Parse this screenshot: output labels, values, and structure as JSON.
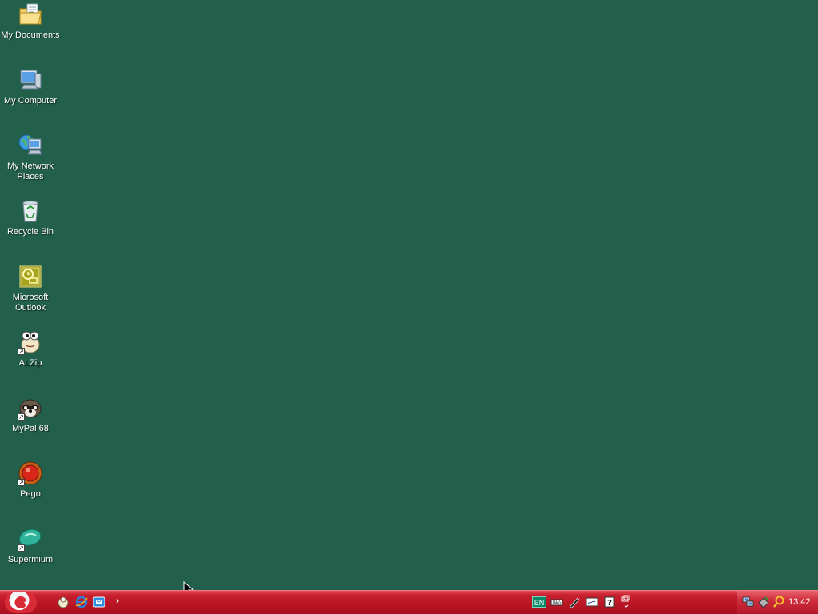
{
  "desktop": {
    "background": "#23604c",
    "icons": [
      {
        "label": "My Documents",
        "icon": "folder-documents-icon",
        "shortcut": false
      },
      {
        "label": "My Computer",
        "icon": "computer-icon",
        "shortcut": false
      },
      {
        "label": "My Network Places",
        "icon": "network-places-icon",
        "shortcut": false
      },
      {
        "label": "Recycle Bin",
        "icon": "recycle-bin-icon",
        "shortcut": false
      },
      {
        "label": "Microsoft Outlook",
        "icon": "outlook-icon",
        "shortcut": false
      },
      {
        "label": "ALZip",
        "icon": "alzip-icon",
        "shortcut": true
      },
      {
        "label": "MyPal 68",
        "icon": "mypal-icon",
        "shortcut": true
      },
      {
        "label": "Pego",
        "icon": "pego-icon",
        "shortcut": true
      },
      {
        "label": "Supermium",
        "icon": "supermium-icon",
        "shortcut": true
      }
    ]
  },
  "taskbar": {
    "color": "#b81624",
    "start_icon": "start-logo-icon",
    "quick_launch": [
      "show-desktop-icon",
      "internet-explorer-icon",
      "outlook-express-icon"
    ],
    "quick_launch_more": "›",
    "language_bar": {
      "language": "EN",
      "items": [
        "keyboard-icon",
        "handwriting-icon",
        "writing-pad-icon",
        "help-icon",
        "minimize-langbar-icon"
      ]
    },
    "tray": {
      "icons": [
        "network-connection-icon",
        "safely-remove-icon",
        "search-icon"
      ],
      "clock": "13:42"
    }
  }
}
